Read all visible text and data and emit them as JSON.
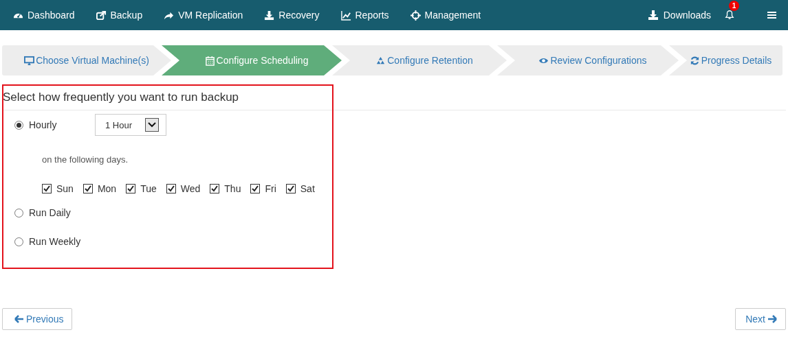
{
  "navbar": {
    "items": [
      {
        "label": "Dashboard"
      },
      {
        "label": "Backup"
      },
      {
        "label": "VM Replication"
      },
      {
        "label": "Recovery"
      },
      {
        "label": "Reports"
      },
      {
        "label": "Management"
      }
    ],
    "downloads": "Downloads",
    "notifications": {
      "badge": "1"
    }
  },
  "steps": [
    {
      "label": "Choose Virtual Machine(s)",
      "selected": false
    },
    {
      "label": "Configure Scheduling",
      "selected": true
    },
    {
      "label": "Configure Retention",
      "selected": false
    },
    {
      "label": "Review Configurations",
      "selected": false
    },
    {
      "label": "Progress Details",
      "selected": false
    }
  ],
  "schedule": {
    "heading": "Select how frequently you want to run backup",
    "options": [
      {
        "label": "Hourly",
        "selected": true,
        "interval": {
          "value": "1 Hour"
        },
        "days_caption": "on the following days.",
        "days": [
          {
            "label": "Sun",
            "checked": true
          },
          {
            "label": "Mon",
            "checked": true
          },
          {
            "label": "Tue",
            "checked": true
          },
          {
            "label": "Wed",
            "checked": true
          },
          {
            "label": "Thu",
            "checked": true
          },
          {
            "label": "Fri",
            "checked": true
          },
          {
            "label": "Sat",
            "checked": true
          }
        ]
      },
      {
        "label": "Run Daily",
        "selected": false
      },
      {
        "label": "Run Weekly",
        "selected": false
      }
    ]
  },
  "buttons": {
    "previous": "Previous",
    "next": "Next"
  }
}
